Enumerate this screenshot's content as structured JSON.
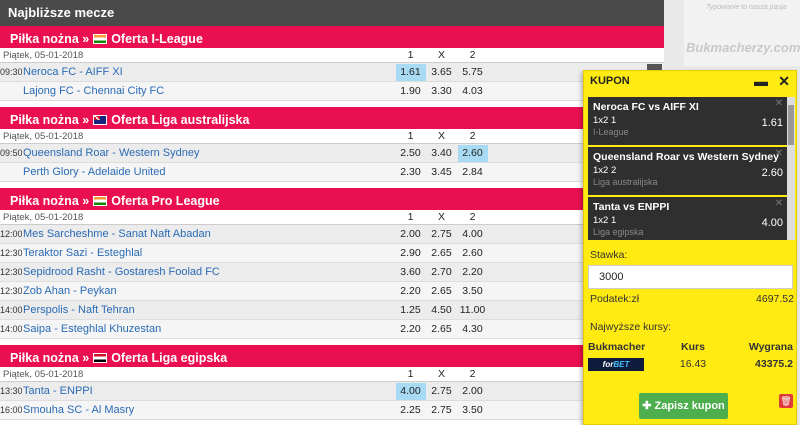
{
  "page_title": "Najbliższe mecze",
  "sections": [
    {
      "header": "Piłka nożna » ",
      "league": "Oferta I-League",
      "flag": "india",
      "date": "Piątek, 05-01-2018",
      "cols": [
        "1",
        "X",
        "2"
      ],
      "matches": [
        {
          "time": "09:30",
          "name": "Neroca FC - AIFF XI",
          "odds": [
            "1.61",
            "3.65",
            "5.75"
          ],
          "selected": 0
        },
        {
          "time": "",
          "name": "Lajong FC - Chennai City FC",
          "odds": [
            "1.90",
            "3.30",
            "4.03"
          ],
          "selected": -1
        }
      ]
    },
    {
      "header": "Piłka nożna » ",
      "league": "Oferta Liga australijska",
      "flag": "australia",
      "date": "Piątek, 05-01-2018",
      "cols": [
        "1",
        "X",
        "2"
      ],
      "matches": [
        {
          "time": "09:50",
          "name": "Queensland Roar - Western Sydney",
          "odds": [
            "2.50",
            "3.40",
            "2.60"
          ],
          "selected": 2
        },
        {
          "time": "",
          "name": "Perth Glory - Adelaide United",
          "odds": [
            "2.30",
            "3.45",
            "2.84"
          ],
          "selected": -1
        }
      ]
    },
    {
      "header": "Piłka nożna » ",
      "league": "Oferta Pro League",
      "flag": "india",
      "date": "Piątek, 05-01-2018",
      "cols": [
        "1",
        "X",
        "2"
      ],
      "matches": [
        {
          "time": "12:00",
          "name": "Mes Sarcheshme - Sanat Naft Abadan",
          "odds": [
            "2.00",
            "2.75",
            "4.00"
          ],
          "selected": -1
        },
        {
          "time": "12:30",
          "name": "Teraktor Sazi - Esteghlal",
          "odds": [
            "2.90",
            "2.65",
            "2.60"
          ],
          "selected": -1
        },
        {
          "time": "12:30",
          "name": "Sepidrood Rasht - Gostaresh Foolad FC",
          "odds": [
            "3.60",
            "2.70",
            "2.20"
          ],
          "selected": -1
        },
        {
          "time": "12:30",
          "name": "Zob Ahan - Peykan",
          "odds": [
            "2.20",
            "2.65",
            "3.50"
          ],
          "selected": -1
        },
        {
          "time": "14:00",
          "name": "Perspolis - Naft Tehran",
          "odds": [
            "1.25",
            "4.50",
            "11.00"
          ],
          "selected": -1
        },
        {
          "time": "14:00",
          "name": "Saipa - Esteghlal Khuzestan",
          "odds": [
            "2.20",
            "2.65",
            "4.30"
          ],
          "selected": -1
        }
      ]
    },
    {
      "header": "Piłka nożna » ",
      "league": "Oferta Liga egipska",
      "flag": "egypt",
      "date": "Piątek, 05-01-2018",
      "cols": [
        "1",
        "X",
        "2"
      ],
      "matches": [
        {
          "time": "13:30",
          "name": "Tanta - ENPPI",
          "odds": [
            "4.00",
            "2.75",
            "2.00"
          ],
          "selected": 0
        },
        {
          "time": "16:00",
          "name": "Smouha SC - Al Masry",
          "odds": [
            "2.25",
            "2.75",
            "3.50"
          ],
          "selected": -1
        }
      ]
    }
  ],
  "ad": {
    "tagline": "Typowanie to nasza pasja",
    "logo": "Bukmacherzy.com"
  },
  "kupon": {
    "title": "KUPON",
    "minimize": "▬",
    "close": "✕",
    "bets": [
      {
        "match": "Neroca FC vs AIFF XI",
        "type": "1x2 1",
        "league": "I-League",
        "odd": "1.61"
      },
      {
        "match": "Queensland Roar vs Western Sydney",
        "type": "1x2 2",
        "league": "Liga australijska",
        "odd": "2.60"
      },
      {
        "match": "Tanta vs ENPPI",
        "type": "1x2 1",
        "league": "Liga egipska",
        "odd": "4.00"
      }
    ],
    "stawka_label": "Stawka:",
    "stawka_value": "3000",
    "podatek_label": "Podatek:zł",
    "podatek_value": "4697.52",
    "najwyzsze_label": "Najwyższe kursy:",
    "table_headers": [
      "Bukmacher",
      "Kurs",
      "Wygrana"
    ],
    "bookmaker": {
      "name_a": "for",
      "name_b": "BET",
      "kurs": "16.43",
      "wygrana": "43375.2"
    },
    "save_label": "Zapisz kupon",
    "colors": {
      "bg": "#ffeb11",
      "save": "#4cae4c",
      "trash": "#e03a3a"
    }
  },
  "colors": {
    "section_header": "#ea0f51",
    "topbar": "#4a4a4a",
    "link": "#2a6bb5",
    "selected_odd": "#a8dbf3"
  }
}
